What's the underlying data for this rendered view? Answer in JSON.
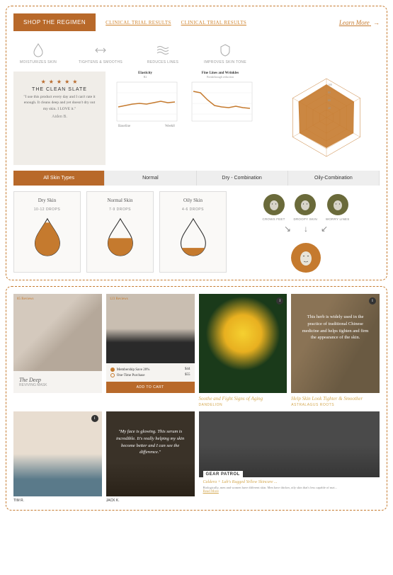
{
  "top": {
    "shop_btn": "SHOP THE REGIMEN",
    "trial1": "CLINICAL TRIAL RESULTS",
    "trial2": "CLINICAL TRIAL RESULTS",
    "learn_more": "Learn More"
  },
  "benefits": [
    {
      "label": "MOISTURIZES SKIN"
    },
    {
      "label": "TIGHTENS & SMOOTHS"
    },
    {
      "label": "REDUCES LINES"
    },
    {
      "label": "IMPROVES SKIN TONE"
    }
  ],
  "testimonial": {
    "stars": "★ ★ ★ ★ ★",
    "title": "THE CLEAN SLATE",
    "quote": "\"I use this product every day and I can't rate it enough. It cleans deep and yet doesn't dry out my skin. I LOVE it.\"",
    "author": "Aiden B."
  },
  "chart_data": [
    {
      "type": "line",
      "title": "Elasticity",
      "subtitle": "R2",
      "x": [
        "Baseline",
        "Week8"
      ],
      "values": [
        42,
        44,
        46,
        47,
        46.5,
        48,
        50,
        48,
        49
      ],
      "ylim": [
        20,
        60
      ]
    },
    {
      "type": "line",
      "title": "Fine Lines and Wrinkles",
      "subtitle": "Breakthrough reduction",
      "x": [
        "",
        ""
      ],
      "values": [
        52,
        50,
        40,
        32,
        30,
        29,
        31,
        29,
        28
      ],
      "ylim": [
        20,
        60
      ]
    },
    {
      "type": "radar",
      "axes": [
        "",
        "",
        "",
        "",
        "",
        ""
      ],
      "ticks": [
        20,
        40,
        60,
        80,
        100
      ],
      "values": [
        85,
        82,
        80,
        78,
        80,
        83
      ]
    }
  ],
  "tabs": [
    "All Skin Types",
    "Normal",
    "Dry - Combination",
    "Oily-Combination"
  ],
  "drop_cards": [
    {
      "title": "Dry Skin",
      "drops": "10-12 DROPS",
      "fill": 0.92
    },
    {
      "title": "Normal Skin",
      "drops": "7-9 DROPS",
      "fill": 0.55
    },
    {
      "title": "Oily Skin",
      "drops": "4-6 DROPS",
      "fill": 0.22
    }
  ],
  "faces": [
    {
      "label": "CROWS FEET"
    },
    {
      "label": "DROOPY SKIN"
    },
    {
      "label": "WORRY LINES"
    }
  ],
  "cards": {
    "deep": {
      "reviews": "85 Reviews",
      "title": "The Deep",
      "sub": "REVIVING MASK"
    },
    "base": {
      "reviews": "123 Reviews",
      "opt1": "Membership Save 20%",
      "price1": "$44",
      "opt2": "One-Time Purchase",
      "price2": "$55",
      "btn": "ADD TO CART"
    },
    "dandelion": {
      "title": "Soothe and Fight Signs of Aging",
      "sub": "DANDELION"
    },
    "herb": {
      "text": "This herb is widely used in the practice of traditional Chinese medicine and helps tighten and firm the appearance of the skin.",
      "title": "Help Skin Look Tighter & Smoother",
      "sub": "ASTRALAGUS ROOTS"
    },
    "man1": {
      "label": "TIM R."
    },
    "quote": {
      "text": "\"My face is glowing. This serum is incredible. It's really helping my skin become better and I can see the difference.\"",
      "label": "JACK K."
    },
    "gear": {
      "brand": "GEAR PATROL",
      "headline": "Caldera + Lab's Rugged Yellow Skincare ...",
      "body": "Biologically, men and women have different skin. Men have thicker, oily skin that's less capable of mai...",
      "read": "Read More"
    }
  }
}
